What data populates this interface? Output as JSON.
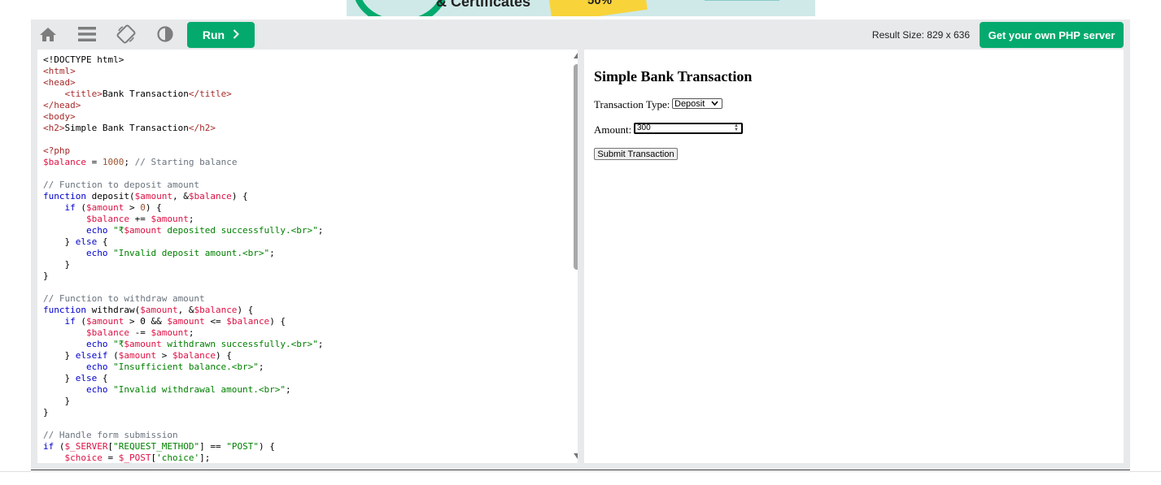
{
  "ad": {
    "headline": "& Certificates",
    "badge": "50%"
  },
  "toolbar": {
    "icons": [
      "home-icon",
      "menu-icon",
      "rotate-icon",
      "contrast-icon"
    ],
    "run_label": "Run",
    "result_size": "Result Size: 829 x 636",
    "php_server_label": "Get your own PHP server"
  },
  "code": {
    "lines": [
      [
        [
          "t-plain",
          "<!DOCTYPE html>"
        ]
      ],
      [
        [
          "t-tag",
          "<html>"
        ]
      ],
      [
        [
          "t-tag",
          "<head>"
        ]
      ],
      [
        [
          "t-plain",
          "    "
        ],
        [
          "t-tag",
          "<title>"
        ],
        [
          "t-plain",
          "Bank Transaction"
        ],
        [
          "t-tag",
          "</title>"
        ]
      ],
      [
        [
          "t-tag",
          "</head>"
        ]
      ],
      [
        [
          "t-tag",
          "<body>"
        ]
      ],
      [
        [
          "t-tag",
          "<h2>"
        ],
        [
          "t-plain",
          "Simple Bank Transaction"
        ],
        [
          "t-tag",
          "</h2>"
        ]
      ],
      [],
      [
        [
          "t-tag",
          "<?php"
        ]
      ],
      [
        [
          "t-var",
          "$balance"
        ],
        [
          "t-plain",
          " = "
        ],
        [
          "t-num",
          "1000"
        ],
        [
          "t-plain",
          "; "
        ],
        [
          "t-cmt",
          "// Starting balance"
        ]
      ],
      [],
      [
        [
          "t-cmt",
          "// Function to deposit amount"
        ]
      ],
      [
        [
          "t-kw",
          "function"
        ],
        [
          "t-plain",
          " deposit("
        ],
        [
          "t-var",
          "$amount"
        ],
        [
          "t-plain",
          ", &"
        ],
        [
          "t-var",
          "$balance"
        ],
        [
          "t-plain",
          ") {"
        ]
      ],
      [
        [
          "t-plain",
          "    "
        ],
        [
          "t-kw",
          "if"
        ],
        [
          "t-plain",
          " ("
        ],
        [
          "t-var",
          "$amount"
        ],
        [
          "t-plain",
          " > "
        ],
        [
          "t-num",
          "0"
        ],
        [
          "t-plain",
          ") {"
        ]
      ],
      [
        [
          "t-plain",
          "        "
        ],
        [
          "t-var",
          "$balance"
        ],
        [
          "t-plain",
          " += "
        ],
        [
          "t-var",
          "$amount"
        ],
        [
          "t-plain",
          ";"
        ]
      ],
      [
        [
          "t-plain",
          "        "
        ],
        [
          "t-kw",
          "echo"
        ],
        [
          "t-plain",
          " "
        ],
        [
          "t-str",
          "\"₹"
        ],
        [
          "t-var",
          "$amount"
        ],
        [
          "t-str",
          " deposited successfully.<br>\""
        ],
        [
          "t-plain",
          ";"
        ]
      ],
      [
        [
          "t-plain",
          "    } "
        ],
        [
          "t-kw",
          "else"
        ],
        [
          "t-plain",
          " {"
        ]
      ],
      [
        [
          "t-plain",
          "        "
        ],
        [
          "t-kw",
          "echo"
        ],
        [
          "t-plain",
          " "
        ],
        [
          "t-str",
          "\"Invalid deposit amount.<br>\""
        ],
        [
          "t-plain",
          ";"
        ]
      ],
      [
        [
          "t-plain",
          "    }"
        ]
      ],
      [
        [
          "t-plain",
          "}"
        ]
      ],
      [],
      [
        [
          "t-cmt",
          "// Function to withdraw amount"
        ]
      ],
      [
        [
          "t-kw",
          "function"
        ],
        [
          "t-plain",
          " withdraw("
        ],
        [
          "t-var",
          "$amount"
        ],
        [
          "t-plain",
          ", &"
        ],
        [
          "t-var",
          "$balance"
        ],
        [
          "t-plain",
          ") {"
        ]
      ],
      [
        [
          "t-plain",
          "    "
        ],
        [
          "t-kw",
          "if"
        ],
        [
          "t-plain",
          " ("
        ],
        [
          "t-var",
          "$amount"
        ],
        [
          "t-plain",
          " > 0 && "
        ],
        [
          "t-var",
          "$amount"
        ],
        [
          "t-plain",
          " <= "
        ],
        [
          "t-var",
          "$balance"
        ],
        [
          "t-plain",
          ") {"
        ]
      ],
      [
        [
          "t-plain",
          "        "
        ],
        [
          "t-var",
          "$balance"
        ],
        [
          "t-plain",
          " -= "
        ],
        [
          "t-var",
          "$amount"
        ],
        [
          "t-plain",
          ";"
        ]
      ],
      [
        [
          "t-plain",
          "        "
        ],
        [
          "t-kw",
          "echo"
        ],
        [
          "t-plain",
          " "
        ],
        [
          "t-str",
          "\"₹"
        ],
        [
          "t-var",
          "$amount"
        ],
        [
          "t-str",
          " withdrawn successfully.<br>\""
        ],
        [
          "t-plain",
          ";"
        ]
      ],
      [
        [
          "t-plain",
          "    } "
        ],
        [
          "t-kw",
          "elseif"
        ],
        [
          "t-plain",
          " ("
        ],
        [
          "t-var",
          "$amount"
        ],
        [
          "t-plain",
          " > "
        ],
        [
          "t-var",
          "$balance"
        ],
        [
          "t-plain",
          ") {"
        ]
      ],
      [
        [
          "t-plain",
          "        "
        ],
        [
          "t-kw",
          "echo"
        ],
        [
          "t-plain",
          " "
        ],
        [
          "t-str",
          "\"Insufficient balance.<br>\""
        ],
        [
          "t-plain",
          ";"
        ]
      ],
      [
        [
          "t-plain",
          "    } "
        ],
        [
          "t-kw",
          "else"
        ],
        [
          "t-plain",
          " {"
        ]
      ],
      [
        [
          "t-plain",
          "        "
        ],
        [
          "t-kw",
          "echo"
        ],
        [
          "t-plain",
          " "
        ],
        [
          "t-str",
          "\"Invalid withdrawal amount.<br>\""
        ],
        [
          "t-plain",
          ";"
        ]
      ],
      [
        [
          "t-plain",
          "    }"
        ]
      ],
      [
        [
          "t-plain",
          "}"
        ]
      ],
      [],
      [
        [
          "t-cmt",
          "// Handle form submission"
        ]
      ],
      [
        [
          "t-kw",
          "if"
        ],
        [
          "t-plain",
          " ("
        ],
        [
          "t-var",
          "$_SERVER"
        ],
        [
          "t-plain",
          "["
        ],
        [
          "t-str",
          "\"REQUEST_METHOD\""
        ],
        [
          "t-plain",
          "] == "
        ],
        [
          "t-str",
          "\"POST\""
        ],
        [
          "t-plain",
          ") {"
        ]
      ],
      [
        [
          "t-plain",
          "    "
        ],
        [
          "t-var",
          "$choice"
        ],
        [
          "t-plain",
          " = "
        ],
        [
          "t-var",
          "$_POST"
        ],
        [
          "t-plain",
          "["
        ],
        [
          "t-str",
          "'choice'"
        ],
        [
          "t-plain",
          "];"
        ]
      ]
    ]
  },
  "result": {
    "title": "Simple Bank Transaction",
    "type_label": "Transaction Type:",
    "type_value": "Deposit",
    "amount_label": "Amount:",
    "amount_value": "300",
    "submit_label": "Submit Transaction"
  }
}
